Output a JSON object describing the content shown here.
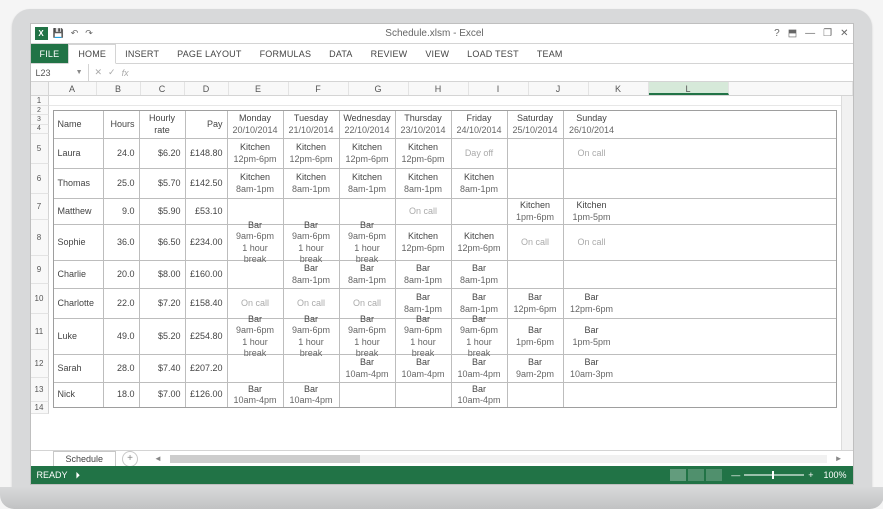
{
  "window": {
    "title": "Schedule.xlsm - Excel"
  },
  "qat": {
    "save": "💾",
    "undo": "↶",
    "redo": "↷"
  },
  "titlebar_right": {
    "help": "?",
    "ribbon_opts": "⬒",
    "min": "—",
    "restore": "❐",
    "close": "✕"
  },
  "ribbon": [
    "FILE",
    "HOME",
    "INSERT",
    "PAGE LAYOUT",
    "FORMULAS",
    "DATA",
    "REVIEW",
    "VIEW",
    "LOAD TEST",
    "TEAM"
  ],
  "namebox": "L23",
  "fx": {
    "cancel": "✕",
    "enter": "✓",
    "label": "fx",
    "value": ""
  },
  "columns": [
    "A",
    "B",
    "C",
    "D",
    "E",
    "F",
    "G",
    "H",
    "I",
    "J",
    "K",
    "L"
  ],
  "selected_col": "L",
  "row_numbers": [
    "1",
    "2",
    "3",
    "4",
    "5",
    "6",
    "7",
    "8",
    "9",
    "10",
    "11",
    "12",
    "13",
    "14"
  ],
  "schedule": {
    "header": {
      "name": "Name",
      "hours": "Hours",
      "rate": "Hourly rate",
      "pay": "Pay",
      "days": [
        {
          "d": "Monday",
          "dt": "20/10/2014"
        },
        {
          "d": "Tuesday",
          "dt": "21/10/2014"
        },
        {
          "d": "Wednesday",
          "dt": "22/10/2014"
        },
        {
          "d": "Thursday",
          "dt": "23/10/2014"
        },
        {
          "d": "Friday",
          "dt": "24/10/2014"
        },
        {
          "d": "Saturday",
          "dt": "25/10/2014"
        },
        {
          "d": "Sunday",
          "dt": "26/10/2014"
        }
      ]
    },
    "rows": [
      {
        "name": "Laura",
        "hours": "24.0",
        "rate": "$6.20",
        "pay": "£148.80",
        "c": [
          {
            "l1": "Kitchen",
            "l2": "12pm-6pm"
          },
          {
            "l1": "Kitchen",
            "l2": "12pm-6pm"
          },
          {
            "l1": "Kitchen",
            "l2": "12pm-6pm"
          },
          {
            "l1": "Kitchen",
            "l2": "12pm-6pm"
          },
          {
            "l1": "Day off",
            "grey": true
          },
          {
            "l1": ""
          },
          {
            "l1": "On call",
            "grey": true
          }
        ]
      },
      {
        "name": "Thomas",
        "hours": "25.0",
        "rate": "$5.70",
        "pay": "£142.50",
        "c": [
          {
            "l1": "Kitchen",
            "l2": "8am-1pm"
          },
          {
            "l1": "Kitchen",
            "l2": "8am-1pm"
          },
          {
            "l1": "Kitchen",
            "l2": "8am-1pm"
          },
          {
            "l1": "Kitchen",
            "l2": "8am-1pm"
          },
          {
            "l1": "Kitchen",
            "l2": "8am-1pm"
          },
          {
            "l1": ""
          },
          {
            "l1": ""
          }
        ]
      },
      {
        "name": "Matthew",
        "hours": "9.0",
        "rate": "$5.90",
        "pay": "£53.10",
        "c": [
          {
            "l1": ""
          },
          {
            "l1": ""
          },
          {
            "l1": ""
          },
          {
            "l1": "On call",
            "grey": true
          },
          {
            "l1": ""
          },
          {
            "l1": "Kitchen",
            "l2": "1pm-6pm"
          },
          {
            "l1": "Kitchen",
            "l2": "1pm-5pm"
          }
        ]
      },
      {
        "name": "Sophie",
        "hours": "36.0",
        "rate": "$6.50",
        "pay": "£234.00",
        "c": [
          {
            "l1": "Bar",
            "l2": "9am-6pm",
            "l3": "1 hour break"
          },
          {
            "l1": "Bar",
            "l2": "9am-6pm",
            "l3": "1 hour break"
          },
          {
            "l1": "Bar",
            "l2": "9am-6pm",
            "l3": "1 hour break"
          },
          {
            "l1": "Kitchen",
            "l2": "12pm-6pm"
          },
          {
            "l1": "Kitchen",
            "l2": "12pm-6pm"
          },
          {
            "l1": "On call",
            "grey": true
          },
          {
            "l1": "On call",
            "grey": true
          }
        ]
      },
      {
        "name": "Charlie",
        "hours": "20.0",
        "rate": "$8.00",
        "pay": "£160.00",
        "c": [
          {
            "l1": ""
          },
          {
            "l1": "Bar",
            "l2": "8am-1pm"
          },
          {
            "l1": "Bar",
            "l2": "8am-1pm"
          },
          {
            "l1": "Bar",
            "l2": "8am-1pm"
          },
          {
            "l1": "Bar",
            "l2": "8am-1pm"
          },
          {
            "l1": ""
          },
          {
            "l1": ""
          }
        ]
      },
      {
        "name": "Charlotte",
        "hours": "22.0",
        "rate": "$7.20",
        "pay": "£158.40",
        "c": [
          {
            "l1": "On call",
            "grey": true
          },
          {
            "l1": "On call",
            "grey": true
          },
          {
            "l1": "On call",
            "grey": true
          },
          {
            "l1": "Bar",
            "l2": "8am-1pm"
          },
          {
            "l1": "Bar",
            "l2": "8am-1pm"
          },
          {
            "l1": "Bar",
            "l2": "12pm-6pm"
          },
          {
            "l1": "Bar",
            "l2": "12pm-6pm"
          }
        ]
      },
      {
        "name": "Luke",
        "hours": "49.0",
        "rate": "$5.20",
        "pay": "£254.80",
        "c": [
          {
            "l1": "Bar",
            "l2": "9am-6pm",
            "l3": "1 hour break"
          },
          {
            "l1": "Bar",
            "l2": "9am-6pm",
            "l3": "1 hour break"
          },
          {
            "l1": "Bar",
            "l2": "9am-6pm",
            "l3": "1 hour break"
          },
          {
            "l1": "Bar",
            "l2": "9am-6pm",
            "l3": "1 hour break"
          },
          {
            "l1": "Bar",
            "l2": "9am-6pm",
            "l3": "1 hour break"
          },
          {
            "l1": "Bar",
            "l2": "1pm-6pm"
          },
          {
            "l1": "Bar",
            "l2": "1pm-5pm"
          }
        ]
      },
      {
        "name": "Sarah",
        "hours": "28.0",
        "rate": "$7.40",
        "pay": "£207.20",
        "c": [
          {
            "l1": ""
          },
          {
            "l1": ""
          },
          {
            "l1": "Bar",
            "l2": "10am-4pm"
          },
          {
            "l1": "Bar",
            "l2": "10am-4pm"
          },
          {
            "l1": "Bar",
            "l2": "10am-4pm"
          },
          {
            "l1": "Bar",
            "l2": "9am-2pm"
          },
          {
            "l1": "Bar",
            "l2": "10am-3pm"
          }
        ]
      },
      {
        "name": "Nick",
        "hours": "18.0",
        "rate": "$7.00",
        "pay": "£126.00",
        "c": [
          {
            "l1": "Bar",
            "l2": "10am-4pm"
          },
          {
            "l1": "Bar",
            "l2": "10am-4pm"
          },
          {
            "l1": ""
          },
          {
            "l1": ""
          },
          {
            "l1": "Bar",
            "l2": "10am-4pm"
          },
          {
            "l1": ""
          },
          {
            "l1": ""
          }
        ]
      }
    ]
  },
  "sheet_tab": "Schedule",
  "add_sheet": "+",
  "scroll_arrows": {
    "l": "◄",
    "r": "►"
  },
  "status": {
    "ready": "READY",
    "macro": "⏵",
    "zoom_minus": "—",
    "zoom_plus": "+",
    "zoom": "100%"
  }
}
